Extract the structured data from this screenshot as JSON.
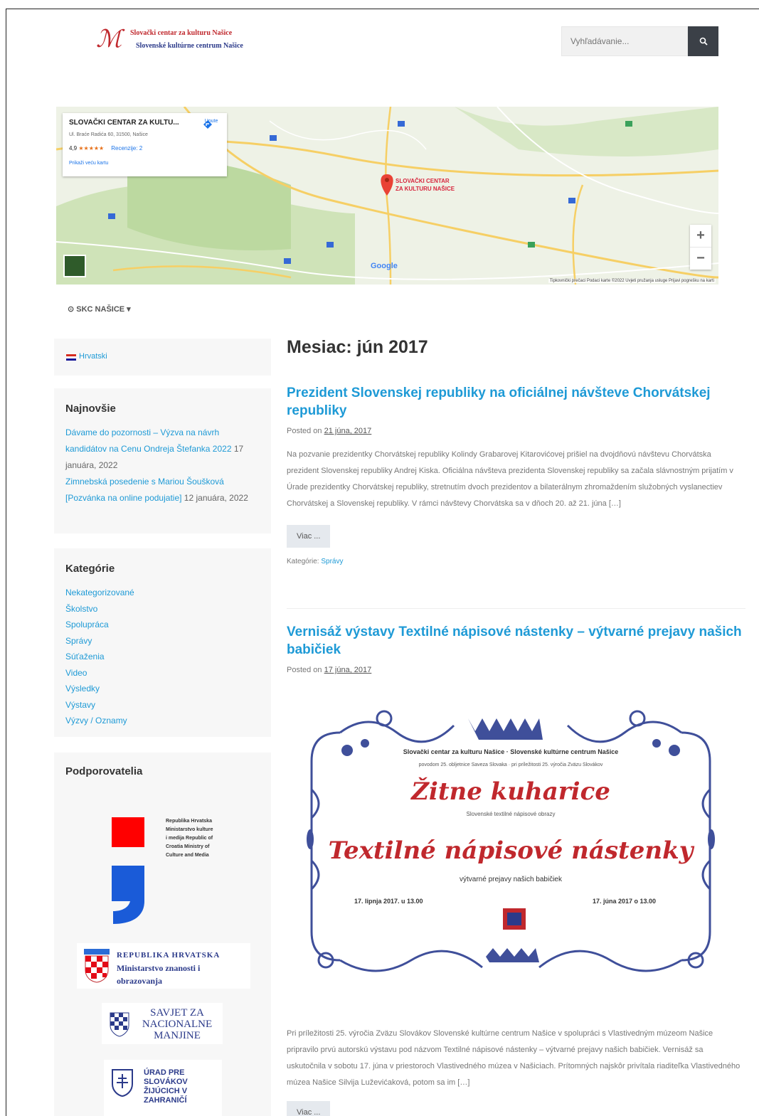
{
  "header": {
    "logo_line1": "Slovački centar za kulturu Našice",
    "logo_line2": "Slovenské kultúrne centrum Našice",
    "search_placeholder": "Vyhľadávanie..."
  },
  "map": {
    "place_name": "SLOVAČKI CENTAR ZA KULTU...",
    "address": "Ul. Braće Radića 60, 31500, Našice",
    "rating": "4,9",
    "stars": "★★★★★",
    "reviews_link": "Recenzije: 2",
    "bigger_map_link": "Prikaži veću kartu",
    "directions_label": "Upute",
    "pin_label_line1": "SLOVAČKI CENTAR",
    "pin_label_line2": "ZA KULTURU NAŠICE",
    "zoom_in": "+",
    "zoom_out": "−",
    "google_logo": "Google",
    "footer": "Tipkovnički prečaci   Podaci karte ©2022   Uvjeti pružanja usluge   Prijavi pogrešku na karti",
    "dropdown_label": "SKC NAŠICE"
  },
  "sidebar": {
    "language_link": "Hrvatski",
    "recent": {
      "title": "Najnovšie",
      "items": [
        {
          "link": "Dávame do pozornosti – Výzva na návrh kandidátov na Cenu Ondreja Štefanka 2022",
          "date": "17 januára, 2022"
        },
        {
          "link": "Zimnebská posedenie s Mariou Šoušková [Pozvánka na online podujatie]",
          "date": "12 januára, 2022"
        }
      ]
    },
    "categories": {
      "title": "Kategórie",
      "items": [
        "Nekategorizované",
        "Školstvo",
        "Spolupráca",
        "Správy",
        "Súťaženia",
        "Video",
        "Výsledky",
        "Výstavy",
        "Výzvy / Oznamy"
      ]
    },
    "supporters": {
      "title": "Podporovatelia",
      "ministry_culture_text": "Republika Hrvatska Ministarstvo kulture i medija Republic of Croatia Ministry of Culture and Media",
      "mzo_line1": "REPUBLIKA HRVATSKA",
      "mzo_line2": "Ministarstvo znanosti i",
      "mzo_line3": "obrazovanja",
      "savjet_text": "SAVJET ZA NACIONALNE MANJINE",
      "urad_text": "ÚRAD PRE SLOVÁKOV ŽIJÚCICH V ZAHRANIČÍ"
    }
  },
  "main": {
    "page_title": "Mesiac: jún 2017",
    "posts": [
      {
        "title": "Prezident Slovenskej republiky na oficiálnej návšteve Chorvátskej republiky",
        "posted_prefix": "Posted on",
        "date": "21 júna, 2017",
        "excerpt": "Na pozvanie prezidentky Chorvátskej republiky Kolindy Grabarovej Kitarovićovej prišiel na dvojdňovú návštevu Chorvátska prezident Slovenskej republiky Andrej Kiska. Oficiálna návšteva prezidenta Slovenskej republiky sa začala slávnostným prijatím v Úrade prezidentky Chorvátskej republiky, stretnutím dvoch prezidentov a bilaterálnym zhromaždením služobných vyslanectiev Chorvátskej a Slovenskej republiky. V rámci návštevy Chorvátska sa v dňoch 20. až 21. júna […]",
        "more_label": "Viac ...",
        "category_prefix": "Kategórie:",
        "category": "Správy"
      },
      {
        "title": "Vernisáž výstavy Textilné nápisové nástenky – výtvarné prejavy našich babičiek",
        "posted_prefix": "Posted on",
        "date": "17 júna, 2017",
        "excerpt": "Pri príležitosti 25. výročia Zväzu Slovákov Slovenské kultúrne centrum Našice v spolupráci s Vlastivedným múzeom Našice pripravilo prvú autorskú výstavu pod názvom Textilné nápisové nástenky – výtvarné prejavy našich babičiek. Vernisáž sa uskutočnila v sobotu 17. júna v priestoroch Vlastivedného múzea v Našiciach. Prítomných najskôr privítala riaditeľka Vlastivedného múzea Našice Silvija Luževićaková, potom sa im […]",
        "more_label": "Viac ..."
      }
    ],
    "poster": {
      "org_line": "Slovački centar za kulturu Našice · Slovenské kultúrne centrum Našice",
      "sub_line": "povodom 25. obljetnice Saveza Slovaka · pri príležitosti 25. výročia Zväzu Slovákov",
      "script1": "Žitne kuharice",
      "sub2": "Slovenské textilné nápisové obrazy",
      "script2": "Textilné nápisové nástenky",
      "sub3": "výtvarné prejavy našich babičiek",
      "date_left": "17. lipnja 2017. u 13.00",
      "date_right": "17. júna 2017 o 13.00"
    }
  }
}
